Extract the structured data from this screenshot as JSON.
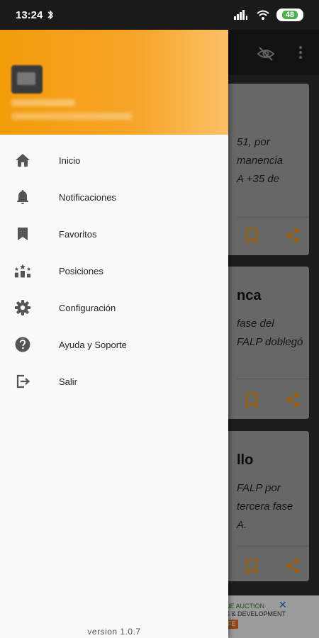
{
  "status_bar": {
    "time": "13:24",
    "battery": "48"
  },
  "background": {
    "cards": [
      {
        "title": "",
        "lines": [
          "51, por",
          "manencia",
          "A +35 de"
        ]
      },
      {
        "title": "nca",
        "lines": [
          "fase del",
          "FALP doblegó"
        ]
      },
      {
        "title": "llo",
        "lines": [
          "FALP por",
          "tercera fase",
          "A."
        ]
      }
    ],
    "ad": {
      "line1": "NE AUCTION",
      "line2": "S & DEVELOPMENT",
      "line3": "FE"
    }
  },
  "drawer": {
    "items": [
      {
        "label": "Inicio",
        "icon": "home-icon"
      },
      {
        "label": "Notificaciones",
        "icon": "bell-icon"
      },
      {
        "label": "Favoritos",
        "icon": "bookmark-icon"
      },
      {
        "label": "Posiciones",
        "icon": "standings-icon"
      },
      {
        "label": "Configuración",
        "icon": "gear-icon"
      },
      {
        "label": "Ayuda y Soporte",
        "icon": "help-icon"
      },
      {
        "label": "Salir",
        "icon": "exit-icon"
      }
    ],
    "version": "version 1.0.7"
  },
  "colors": {
    "accent": "#f39c0b",
    "icon": "#555555",
    "card_accent": "#f29100"
  }
}
